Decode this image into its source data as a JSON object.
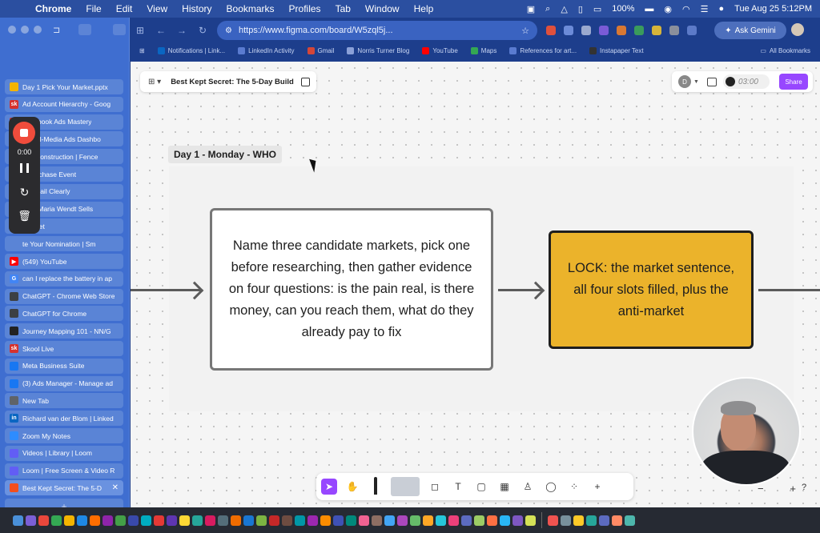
{
  "menubar": {
    "apple": "",
    "app": "Chrome",
    "items": [
      "File",
      "Edit",
      "View",
      "History",
      "Bookmarks",
      "Profiles",
      "Tab",
      "Window",
      "Help"
    ],
    "battery": "100%",
    "datetime": "Tue Aug 25  5:12PM"
  },
  "browser": {
    "url": "https://www.figma.com/board/W5zql5j...",
    "ask_gemini": "Ask Gemini",
    "bookmarks": [
      {
        "label": "Notifications | Link...",
        "color": "#0a66c2"
      },
      {
        "label": "LinkedIn Activity",
        "color": "#5a7bd0"
      },
      {
        "label": "Gmail",
        "color": "#d44638"
      },
      {
        "label": "Norris Turner Blog",
        "color": "#8aa0d8"
      },
      {
        "label": "YouTube",
        "color": "#ff0000"
      },
      {
        "label": "Maps",
        "color": "#34a853"
      },
      {
        "label": "References for art...",
        "color": "#5a7bd0"
      },
      {
        "label": "Instapaper Text",
        "color": "#333333"
      }
    ],
    "all_bookmarks": "All Bookmarks"
  },
  "tabs": [
    {
      "label": "Day 1 Pick Your Market.pptx",
      "fav": "#f4b400",
      "glyph": ""
    },
    {
      "label": "Ad Account Hierarchy - Goog",
      "fav": "#d6322e",
      "glyph": "sk"
    },
    {
      "label": "Facebook Ads Mastery",
      "fav": "#d6322e",
      "glyph": "sk"
    },
    {
      "label": "Digital-Media Ads Dashbo",
      "fav": "#5a84d6",
      "glyph": ""
    },
    {
      "label": "nez Construction | Fence",
      "fav": "#5a84d6",
      "glyph": ""
    },
    {
      "label": "p Purchase Event",
      "fav": "#5a84d6",
      "glyph": ""
    },
    {
      "label": "te Email Clearly",
      "fav": "#5a84d6",
      "glyph": ""
    },
    {
      "label": "How Maria Wendt Sells",
      "fav": "#5a84d6",
      "glyph": ""
    },
    {
      "label": "le Meet",
      "fav": "#5a84d6",
      "glyph": ""
    },
    {
      "label": "te Your Nomination | Sm",
      "fav": "#5a84d6",
      "glyph": ""
    },
    {
      "label": "(549) YouTube",
      "fav": "#ff0000",
      "glyph": "▶"
    },
    {
      "label": "can I replace the battery in ap",
      "fav": "#4285f4",
      "glyph": "G"
    },
    {
      "label": "ChatGPT - Chrome Web Store",
      "fav": "#3c4043",
      "glyph": ""
    },
    {
      "label": "ChatGPT for Chrome",
      "fav": "#3c4043",
      "glyph": ""
    },
    {
      "label": "Journey Mapping 101 - NN/G",
      "fav": "#222222",
      "glyph": ""
    },
    {
      "label": "Skool Live",
      "fav": "#d6322e",
      "glyph": "sk"
    },
    {
      "label": "Meta Business Suite",
      "fav": "#1877f2",
      "glyph": ""
    },
    {
      "label": "(3) Ads Manager - Manage ad",
      "fav": "#1877f2",
      "glyph": ""
    },
    {
      "label": "New Tab",
      "fav": "#5f6368",
      "glyph": ""
    },
    {
      "label": "Richard van der Blom | Linked",
      "fav": "#0a66c2",
      "glyph": "in"
    },
    {
      "label": "Zoom My Notes",
      "fav": "#2d8cff",
      "glyph": ""
    },
    {
      "label": "Videos | Library | Loom",
      "fav": "#625df5",
      "glyph": ""
    },
    {
      "label": "Loom | Free Screen & Video R",
      "fav": "#625df5",
      "glyph": ""
    },
    {
      "label": "Best Kept Secret: The 5-D",
      "fav": "#f24e1e",
      "glyph": ""
    }
  ],
  "recorder": {
    "time": "0:00"
  },
  "figma": {
    "file_name": "Best Kept Secret: The 5-Day Build",
    "avatar_letter": "D",
    "timer": "03:00",
    "share": "Share",
    "section_label": "Day 1 - Monday - WHO",
    "card1_text": "Name three candidate markets, pick one before researching, then gather evidence on four questions: is the pain real, is there money, can you reach them, what do they already pay to fix",
    "card2_text": "LOCK: the market sentence, all four slots filled, plus the anti-market",
    "zoom_minus": "−",
    "zoom_plus": "+",
    "help": "?"
  },
  "colors": {
    "accent": "#9747ff",
    "lock_card": "#ebb32b",
    "record": "#f04c3c"
  }
}
